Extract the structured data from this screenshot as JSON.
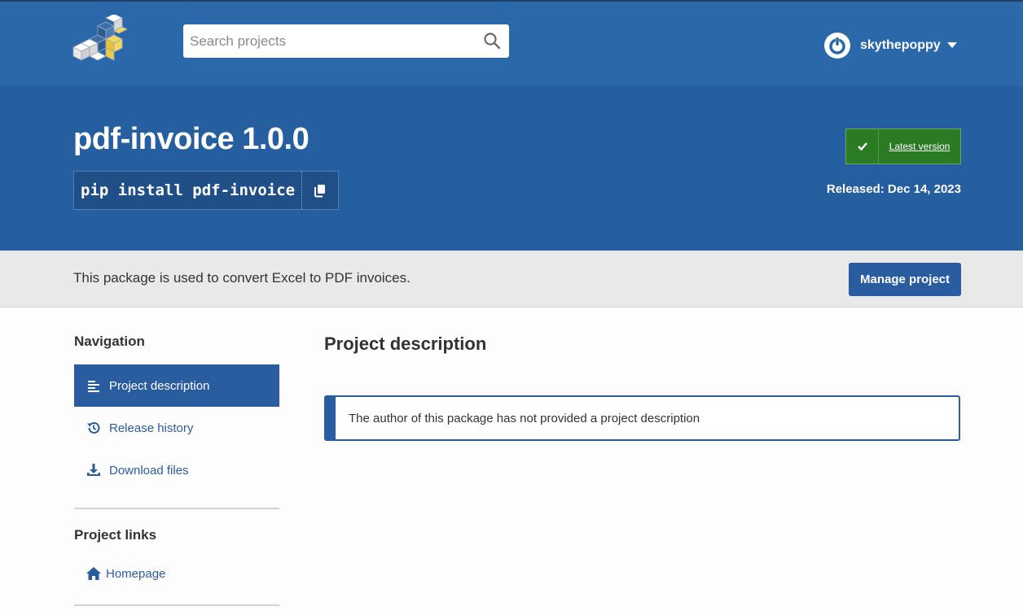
{
  "header": {
    "search_placeholder": "Search projects",
    "username": "skythepoppy"
  },
  "hero": {
    "title": "pdf-invoice 1.0.0",
    "pip_command": "pip install pdf-invoice",
    "latest_label": "Latest version",
    "released": "Released: Dec 14, 2023"
  },
  "summary": {
    "text": "This package is used to convert Excel to PDF invoices.",
    "manage_label": "Manage project"
  },
  "sidebar": {
    "nav_heading": "Navigation",
    "items": [
      {
        "label": "Project description",
        "icon": "align-left-icon",
        "active": true
      },
      {
        "label": "Release history",
        "icon": "history-icon",
        "active": false
      },
      {
        "label": "Download files",
        "icon": "download-icon",
        "active": false
      }
    ],
    "links_heading": "Project links",
    "links": [
      {
        "label": "Homepage",
        "icon": "home-icon"
      }
    ]
  },
  "main": {
    "title": "Project description",
    "callout": "The author of this package has not provided a project description"
  },
  "colors": {
    "header_blue": "#2b68a9",
    "hero_blue": "#265f9f",
    "accent_blue": "#2a5da0",
    "latest_green": "#2a7b24"
  }
}
